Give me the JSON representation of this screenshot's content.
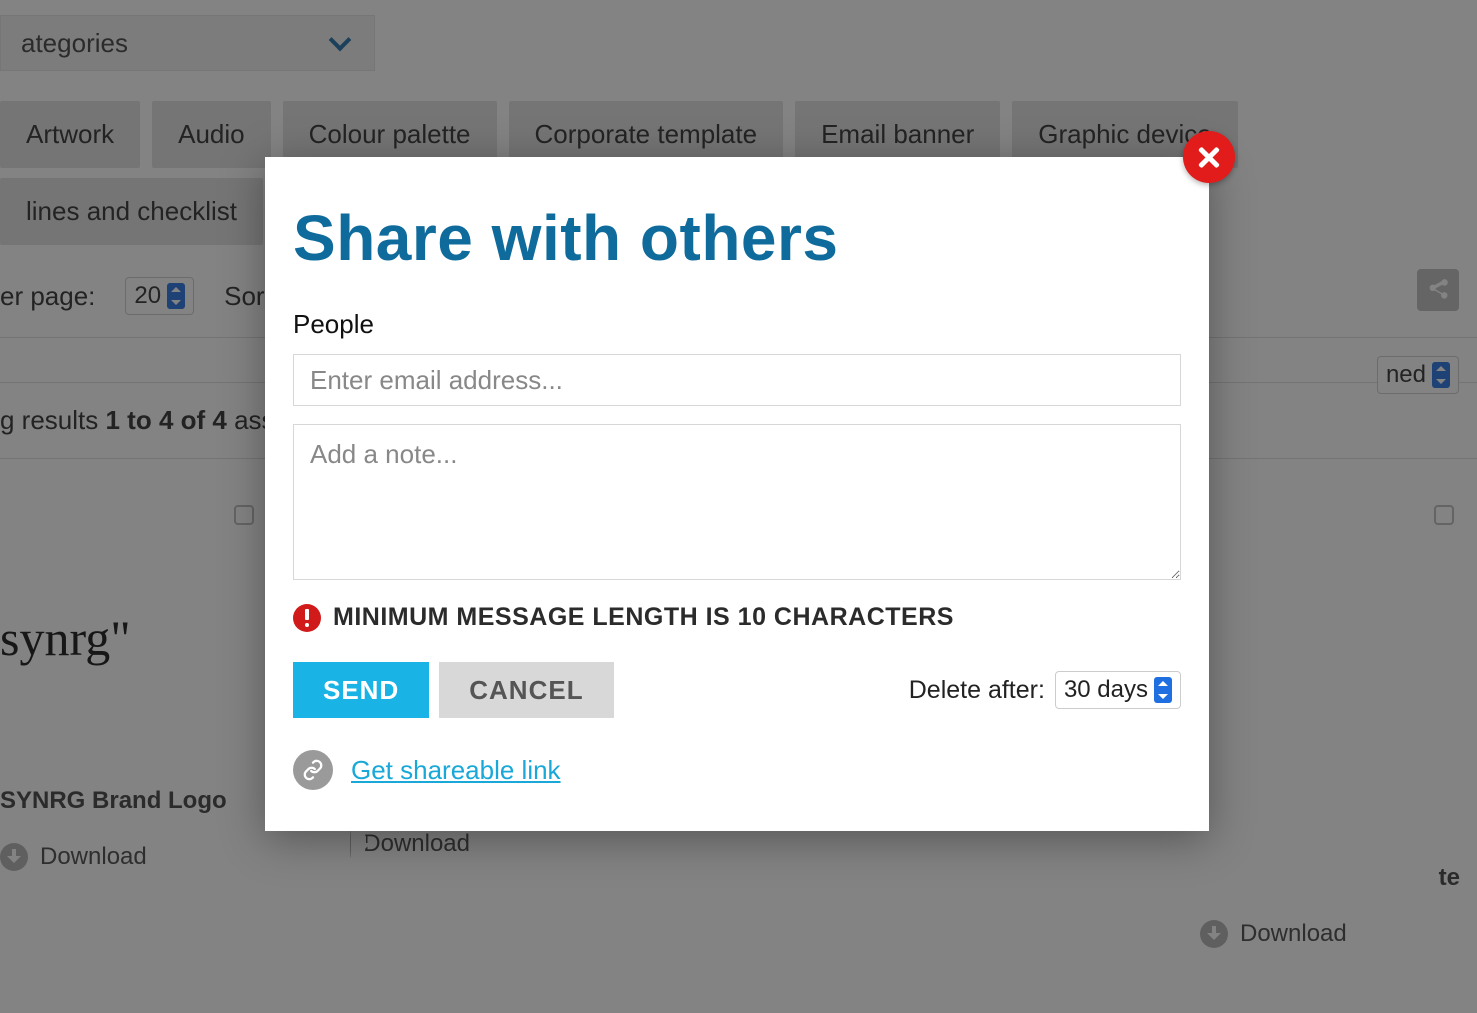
{
  "bg": {
    "categories_label": "ategories",
    "tags": [
      "Artwork",
      "Audio",
      "Colour palette",
      "Corporate template",
      "Email banner",
      "Graphic device"
    ],
    "tag_row2": "lines and checklist",
    "per_page_label": "er page:",
    "per_page_value": "20",
    "sort_label": "Sort b",
    "right_select_value": "ned",
    "results_prefix": "g results ",
    "results_bold": "1 to 4 of 4",
    "results_suffix": " asse",
    "assets": [
      {
        "logo": "synrg\"",
        "title": "SYNRG Brand Logo",
        "download": "Download"
      },
      {
        "logo": "",
        "title": "",
        "download": "Download"
      },
      {
        "logo": "",
        "title": "te",
        "download": "Download"
      }
    ]
  },
  "modal": {
    "title": "Share with others",
    "people_label": "People",
    "email_placeholder": "Enter email address...",
    "note_placeholder": "Add a note...",
    "error_text": "MINIMUM MESSAGE LENGTH IS 10 CHARACTERS",
    "send_label": "SEND",
    "cancel_label": "CANCEL",
    "delete_after_label": "Delete after:",
    "delete_after_value": "30 days",
    "get_link_label": "Get shareable link"
  }
}
